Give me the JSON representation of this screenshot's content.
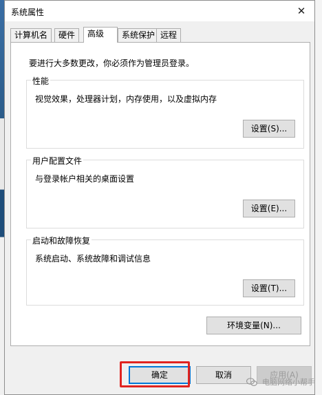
{
  "window": {
    "title": "系统属性",
    "close_glyph": "✕"
  },
  "tabs": [
    {
      "label": "计算机名"
    },
    {
      "label": "硬件"
    },
    {
      "label": "高级"
    },
    {
      "label": "系统保护"
    },
    {
      "label": "远程"
    }
  ],
  "panel": {
    "notice": "要进行大多数更改，你必须作为管理员登录。",
    "performance": {
      "title": "性能",
      "desc": "视觉效果，处理器计划，内存使用，以及虚拟内存",
      "button": "设置(S)..."
    },
    "user_profiles": {
      "title": "用户配置文件",
      "desc": "与登录帐户相关的桌面设置",
      "button": "设置(E)..."
    },
    "startup_recovery": {
      "title": "启动和故障恢复",
      "desc": "系统启动、系统故障和调试信息",
      "button": "设置(T)..."
    },
    "env_button": "环境变量(N)..."
  },
  "footer": {
    "ok": "确定",
    "cancel": "取消",
    "apply": "应用(A)"
  },
  "watermark": "电脑网络小帮手",
  "colors": {
    "highlight": "#e0231f",
    "focus": "#0078d7"
  }
}
